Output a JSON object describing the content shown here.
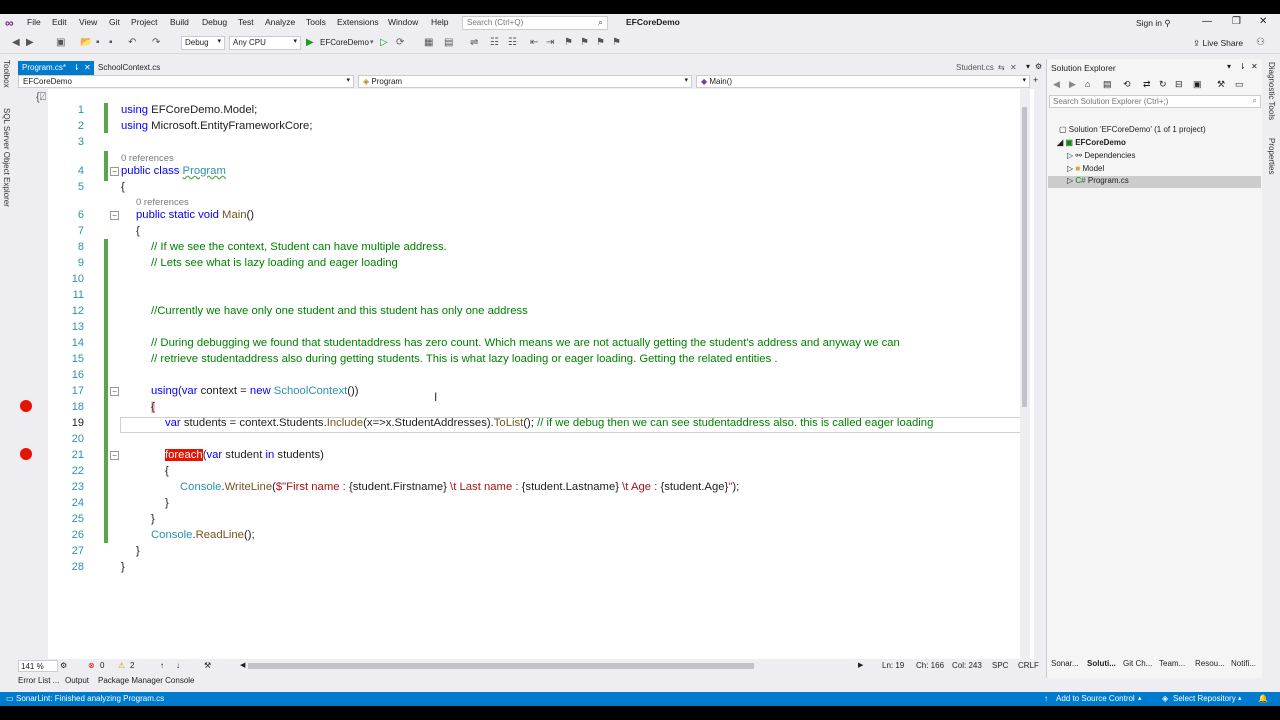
{
  "menu": [
    "File",
    "Edit",
    "View",
    "Git",
    "Project",
    "Build",
    "Debug",
    "Test",
    "Analyze",
    "Tools",
    "Extensions",
    "Window",
    "Help"
  ],
  "search_placeholder": "Search (Ctrl+Q)",
  "solution_title": "EFCoreDemo",
  "sign_in": "Sign in",
  "toolbar": {
    "config": "Debug",
    "platform": "Any CPU",
    "run_target": "EFCoreDemo",
    "live_share": "Live Share"
  },
  "left_strip": [
    "Toolbox",
    "SQL Server Object Explorer"
  ],
  "right_strip": [
    "Diagnostic Tools",
    "Properties"
  ],
  "tabs": {
    "active": "Program.cs*",
    "second": "SchoolContext.cs",
    "preview": "Student.cs"
  },
  "nav": {
    "project": "EFCoreDemo",
    "class": "Program",
    "member": "Main()"
  },
  "code": {
    "l1_kw": "using",
    "l1_rest": " EFCoreDemo.Model;",
    "l2_kw": "using",
    "l2_rest": " Microsoft.EntityFrameworkCore;",
    "ref1": "0 references",
    "l4_kw": "public class",
    "l4_name": "Program",
    "l5": "{",
    "ref2": "0 references",
    "l6_kw": "public static void",
    "l6_name": "Main",
    "l6_rest": "()",
    "l7": "{",
    "l8": "// If we see the context, Student can have multiple address.",
    "l9": "// Lets see what is lazy loading and eager loading",
    "l12": "//Currently we have only one student and this student has only one address",
    "l14": "// During debugging we found that studentaddress has zero count. Which means we are not actually getting the student's address and anyway we can",
    "l15": "// retrieve studentaddress also during getting students. This is what lazy loading or eager loading. Getting the related entities .",
    "l17_kw": "using",
    "l17_a": "(",
    "l17_var": "var",
    "l17_b": " context = ",
    "l17_new": "new",
    "l17_type": "SchoolContext",
    "l17_c": "())",
    "l18": "{",
    "l19_var": "var",
    "l19_a": " students = context.Students.",
    "l19_inc": "Include",
    "l19_b": "(x=>x.StudentAddresses).",
    "l19_tl": "ToList",
    "l19_c": "(); ",
    "l19_cm": "// if we debug then we can see studentaddress also. this is called eager loading",
    "l21_kw": "foreach",
    "l21_a": "(",
    "l21_var": "var",
    "l21_b": " student ",
    "l21_in": "in",
    "l21_c": " students)",
    "l22": "{",
    "l23_cls": "Console",
    "l23_a": ".",
    "l23_m": "WriteLine",
    "l23_b": "(",
    "l23_s1": "$\"First name : ",
    "l23_i1": "{student.Firstname}",
    "l23_s2": " \\t Last name : ",
    "l23_i2": "{student.Lastname}",
    "l23_s3": " \\t Age : ",
    "l23_i3": "{student.Age}",
    "l23_s4": "\"",
    "l23_c": ");",
    "l24": "}",
    "l25": "}",
    "l26_cls": "Console",
    "l26_a": ".",
    "l26_m": "ReadLine",
    "l26_b": "();",
    "l27": "}",
    "l28": "}"
  },
  "line_numbers": [
    "1",
    "2",
    "3",
    "4",
    "5",
    "6",
    "7",
    "8",
    "9",
    "10",
    "11",
    "12",
    "13",
    "14",
    "15",
    "16",
    "17",
    "18",
    "19",
    "20",
    "21",
    "22",
    "23",
    "24",
    "25",
    "26",
    "27",
    "28"
  ],
  "editor_status": {
    "zoom": "141 %",
    "errors": "0",
    "warnings": "2",
    "ln": "Ln: 19",
    "ch": "Ch: 166",
    "col": "Col: 243",
    "spc": "SPC",
    "crlf": "CRLF"
  },
  "bottom_tabs": [
    "Error List ...",
    "Output",
    "Package Manager Console"
  ],
  "status_bar": {
    "message": "SonarLint: Finished analyzing Program.cs",
    "source_control": "Add to Source Control",
    "repo": "Select Repository"
  },
  "solution_explorer": {
    "title": "Solution Explorer",
    "search": "Search Solution Explorer (Ctrl+;)",
    "solution": "Solution 'EFCoreDemo' (1 of 1 project)",
    "project": "EFCoreDemo",
    "dependencies": "Dependencies",
    "model": "Model",
    "program": "Program.cs",
    "tabs": [
      "Sonar...",
      "Soluti...",
      "Git Ch...",
      "Team...",
      "Resou...",
      "Notifi..."
    ]
  }
}
